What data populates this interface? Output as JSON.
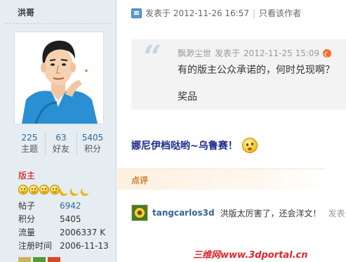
{
  "profile": {
    "username": "洪哥",
    "stats": [
      {
        "value": "225",
        "label": "主题"
      },
      {
        "value": "63",
        "label": "好友"
      },
      {
        "value": "5405",
        "label": "积分"
      }
    ],
    "rank": "版主",
    "star_icons": [
      "smiley-icon",
      "smiley-icon",
      "smiley-icon",
      "smiley-icon",
      "moon-icon",
      "moon-icon",
      "moon-icon"
    ],
    "info": [
      {
        "key": "帖子",
        "value": "6942"
      },
      {
        "key": "积分",
        "value": "5405"
      },
      {
        "key": "流量",
        "value": "2006337 K"
      },
      {
        "key": "注册时间",
        "value": "2006-11-13"
      }
    ],
    "medal_colors": [
      "#c8b560",
      "#4f9a3a",
      "#d9482b"
    ]
  },
  "post": {
    "posted_prefix": "发表于",
    "posted_time": "2012-11-26 16:57",
    "only_author": "只看该作者",
    "quote": {
      "author": "飘渺尘世",
      "prefix": "发表于",
      "time": "2012-11-25 15:09",
      "text": "有的版主公众承诺的，何时兑现啊？",
      "text2": "奖品"
    },
    "body": "娜尼伊档哒哟~乌鲁赛！",
    "review_title": "点评",
    "comment": {
      "user": "tangcarlos3d",
      "text": "洪版太厉害了，还会洋文！",
      "time_prefix": "发表于"
    }
  },
  "watermark": "三维网www.3dportal.cn",
  "colors": {
    "sidebar_bg": "#e5edf2",
    "link_blue": "#336699",
    "rank_red": "#cc0000",
    "review_orange": "#d07c29",
    "body_text": "#1d2b8f"
  }
}
